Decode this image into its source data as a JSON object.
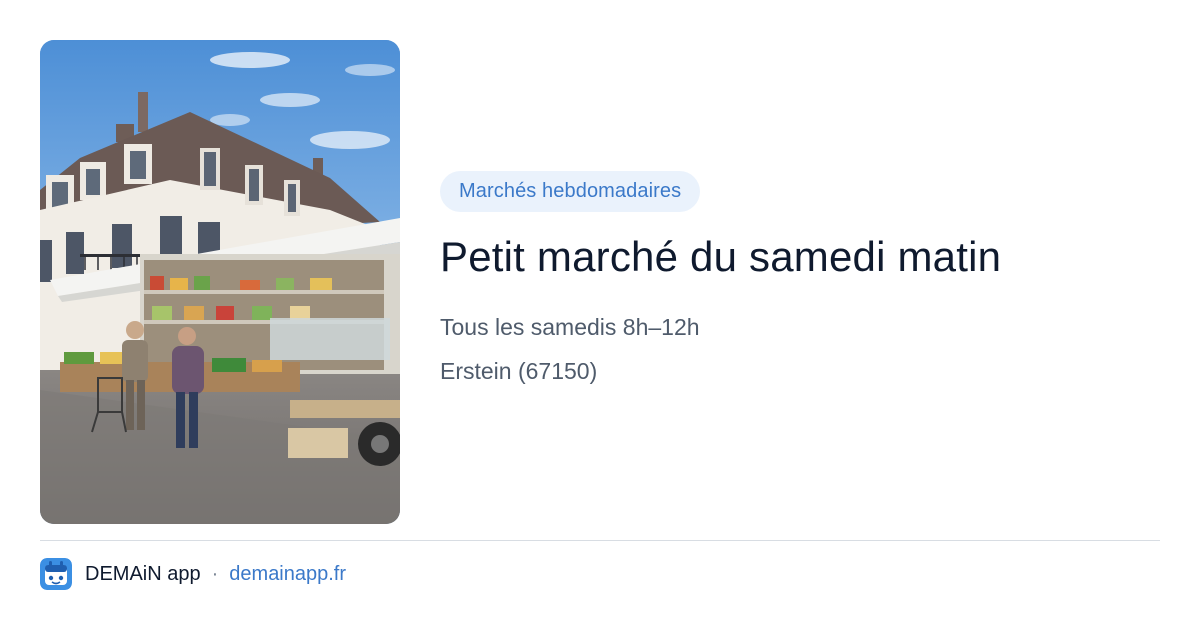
{
  "image": {
    "alt": "Marché en plein air devant un bâtiment",
    "sky_color": "#6fa3d8",
    "building_color": "#f1ede6",
    "roof_color": "#6b5a55"
  },
  "event": {
    "category": "Marchés hebdomadaires",
    "title": "Petit marché du samedi matin",
    "schedule": "Tous les samedis 8h–12h",
    "location": "Erstein (67150)"
  },
  "footer": {
    "logo_icon": "demain-app-logo-icon",
    "app_name": "DEMAiN app",
    "separator": "·",
    "link_text": "demainapp.fr"
  },
  "colors": {
    "accent": "#3b79c9",
    "badge_bg": "#eaf2fc",
    "title": "#0f1a2e",
    "muted": "#4f5b6b",
    "logo_bg": "#3b8fe3"
  }
}
